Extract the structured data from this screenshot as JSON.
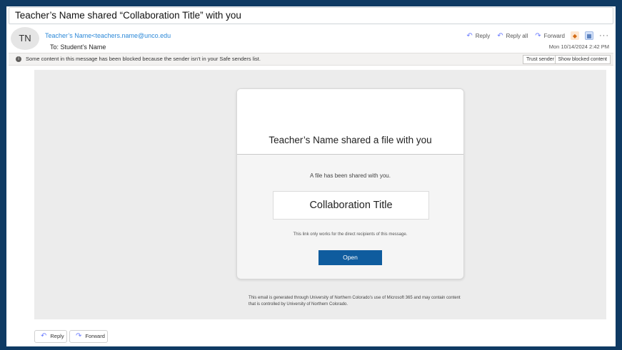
{
  "email": {
    "subject": "Teacher’s Name shared “Collaboration Title” with you",
    "sender_initials": "TN",
    "from": "Teacher’s Name<teachers.name@unco.edu",
    "to": "To:  Student’s Name",
    "date": "Mon 10/14/2024 2:42 PM",
    "actions": {
      "reply": "Reply",
      "reply_all": "Reply all",
      "forward": "Forward"
    }
  },
  "infobar": {
    "message": "Some content in this message has been blocked because the sender isn’t in your Safe senders list.",
    "trust_sender": "Trust sender",
    "show_blocked": "Show blocked content"
  },
  "card": {
    "title": "Teacher’s Name shared a file with you",
    "subtitle": "A file has been shared with you.",
    "file_name": "Collaboration Title",
    "note": "This link only works for the direct recipients of this message.",
    "open_label": "Open"
  },
  "footer": {
    "disclaimer": "This email is generated through University of Northern Colorado’s use of Microsoft 365 and may contain content that is controlled by University of Northern Colorado."
  },
  "bottom_actions": {
    "reply": "Reply",
    "forward": "Forward"
  },
  "icons": {
    "reply": "reply-arrow-icon",
    "reply_all": "reply-all-icon",
    "forward": "forward-arrow-icon",
    "office_apps": "office-apps-icon",
    "immersive_reader": "immersive-reader-icon",
    "more": "more-options-icon",
    "info": "info-icon"
  },
  "colors": {
    "frame": "#0f3a63",
    "link": "#2b88d8",
    "open_button": "#0f5c9e",
    "action_icon": "#6b7cff"
  }
}
